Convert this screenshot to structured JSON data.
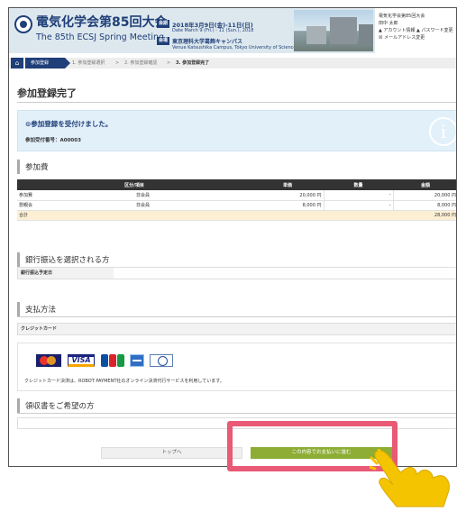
{
  "header": {
    "title_ja": "電気化学会第85回大会",
    "title_en": "The 85th ECSJ Spring Meeting",
    "tag_date": "会期",
    "tag_venue": "会場",
    "date_ja": "2018年3月9日(金)-11日(日)",
    "date_en": "Date March 9 (Fri.) - 11 (Sun.), 2018",
    "venue_ja": "東京理科大学葛飾キャンパス",
    "venue_en": "Venue Katsushika Campus, Tokyo University of Science",
    "side_title": "電気化学会第85回大会",
    "side_user": "田中 太郎",
    "side_links1": "▲ アカウント情報 ▲ パスワード変更",
    "side_links2": "☒ メールアドレス変更"
  },
  "breadcrumb": {
    "home_icon": "home-icon",
    "current": "参加登録",
    "step1": "1. 参加登録選択",
    "step2": "2. 参加登録確認",
    "step3": "3. 参加登録完了"
  },
  "page_title": "参加登録完了",
  "notice": {
    "message": "⊙参加登録を受付けました。",
    "number": "参加受付番号：A00003"
  },
  "fees": {
    "section": "参加費",
    "headers": [
      "区分/項目",
      "単価",
      "数量",
      "金額"
    ],
    "rows": [
      {
        "item": "参加費",
        "type": "非会員",
        "unit": "20,000 円",
        "qty": "-",
        "amount": "20,000 円"
      },
      {
        "item": "懇親会",
        "type": "非会員",
        "unit": "8,000 円",
        "qty": "-",
        "amount": "8,000 円"
      }
    ],
    "total_label": "合計",
    "total_amount": "28,000 円"
  },
  "bank": {
    "section": "銀行振込を選択される方",
    "label": "銀行振込予定日"
  },
  "payment": {
    "section": "支払方法",
    "label": "クレジットカード",
    "cards": [
      "Mastercard",
      "VISA",
      "JCB",
      "American Express",
      "Diners Club"
    ],
    "note": "クレジットカード決済は、ROBOT PAYMENT社のオンライン決済代行サービスを利用しています。"
  },
  "receipt": {
    "section": "領収書をご希望の方"
  },
  "buttons": {
    "top": "トップへ",
    "pay": "この内容でお支払いに進む"
  },
  "colors": {
    "brand": "#1f3f78",
    "pay_button": "#8dad35",
    "highlight": "#e85a75",
    "hand": "#f5c400"
  }
}
